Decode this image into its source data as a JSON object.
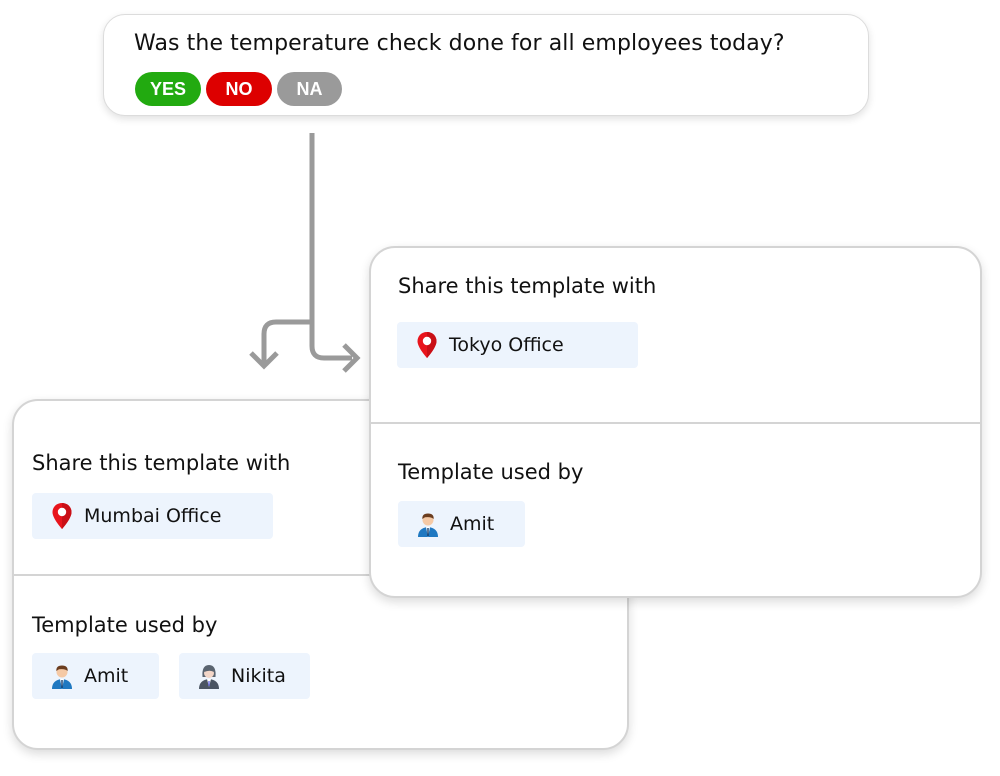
{
  "question": {
    "text": "Was the temperature check done for all employees today?",
    "answers": [
      {
        "label": "YES",
        "color": "#22aa10"
      },
      {
        "label": "NO",
        "color": "#dd0000"
      },
      {
        "label": "NA",
        "color": "#9a9a9a"
      }
    ]
  },
  "cards": {
    "mumbai": {
      "share_title": "Share this template with",
      "location": {
        "label": "Mumbai Office",
        "icon": "location-pin-icon"
      },
      "used_by_title": "Template used by",
      "users": [
        {
          "label": "Amit",
          "icon": "male-avatar-icon"
        },
        {
          "label": "Nikita",
          "icon": "female-avatar-icon"
        }
      ]
    },
    "tokyo": {
      "share_title": "Share this template with",
      "location": {
        "label": "Tokyo Office",
        "icon": "location-pin-icon"
      },
      "used_by_title": "Template used by",
      "users": [
        {
          "label": "Amit",
          "icon": "male-avatar-icon"
        }
      ]
    }
  },
  "colors": {
    "chip_bg": "#edf4fd",
    "arrow": "#9a9a9a",
    "pin": "#e8141c"
  }
}
